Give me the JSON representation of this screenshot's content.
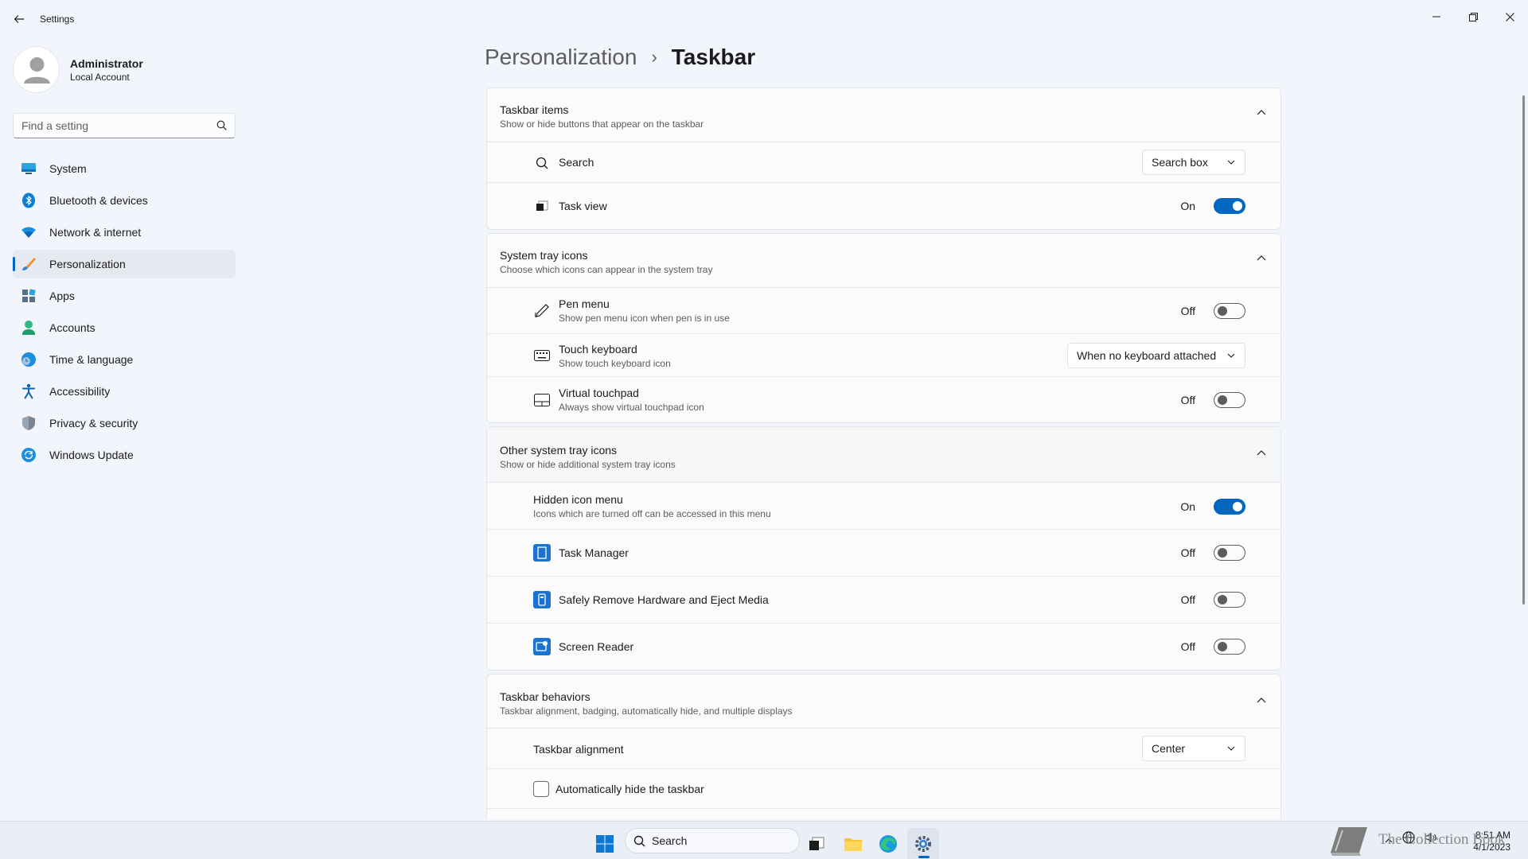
{
  "window": {
    "app_title": "Settings"
  },
  "profile": {
    "name": "Administrator",
    "account_type": "Local Account"
  },
  "search": {
    "placeholder": "Find a setting"
  },
  "sidebar": {
    "items": [
      {
        "label": "System",
        "icon": "display-icon"
      },
      {
        "label": "Bluetooth & devices",
        "icon": "bluetooth-icon"
      },
      {
        "label": "Network & internet",
        "icon": "wifi-icon"
      },
      {
        "label": "Personalization",
        "icon": "brush-icon",
        "active": true
      },
      {
        "label": "Apps",
        "icon": "apps-icon"
      },
      {
        "label": "Accounts",
        "icon": "person-icon"
      },
      {
        "label": "Time & language",
        "icon": "globe-clock-icon"
      },
      {
        "label": "Accessibility",
        "icon": "accessibility-icon"
      },
      {
        "label": "Privacy & security",
        "icon": "shield-icon"
      },
      {
        "label": "Windows Update",
        "icon": "update-icon"
      }
    ]
  },
  "breadcrumb": {
    "parent": "Personalization",
    "separator": "›",
    "current": "Taskbar"
  },
  "taskbar_items": {
    "title": "Taskbar items",
    "subtitle": "Show or hide buttons that appear on the taskbar",
    "search": {
      "label": "Search",
      "value": "Search box"
    },
    "task_view": {
      "label": "Task view",
      "state": "On"
    }
  },
  "system_tray": {
    "title": "System tray icons",
    "subtitle": "Choose which icons can appear in the system tray",
    "pen_menu": {
      "label": "Pen menu",
      "desc": "Show pen menu icon when pen is in use",
      "state": "Off"
    },
    "touch_keyboard": {
      "label": "Touch keyboard",
      "desc": "Show touch keyboard icon",
      "value": "When no keyboard attached"
    },
    "virtual_touchpad": {
      "label": "Virtual touchpad",
      "desc": "Always show virtual touchpad icon",
      "state": "Off"
    }
  },
  "other_tray": {
    "title": "Other system tray icons",
    "subtitle": "Show or hide additional system tray icons",
    "hidden_menu": {
      "label": "Hidden icon menu",
      "desc": "Icons which are turned off can be accessed in this menu",
      "state": "On"
    },
    "task_manager": {
      "label": "Task Manager",
      "state": "Off"
    },
    "safely_remove": {
      "label": "Safely Remove Hardware and Eject Media",
      "state": "Off"
    },
    "screen_reader": {
      "label": "Screen Reader",
      "state": "Off"
    }
  },
  "behaviors": {
    "title": "Taskbar behaviors",
    "subtitle": "Taskbar alignment, badging, automatically hide, and multiple displays",
    "alignment": {
      "label": "Taskbar alignment",
      "value": "Center"
    },
    "auto_hide": {
      "label": "Automatically hide the taskbar"
    }
  },
  "taskbar": {
    "search_label": "Search",
    "time": "8:51 AM",
    "date": "4/1/2023",
    "watermark": "The Collection Book"
  },
  "colors": {
    "accent": "#0067c0",
    "background": "#f2f5fb",
    "card": "#fbfbfc"
  }
}
